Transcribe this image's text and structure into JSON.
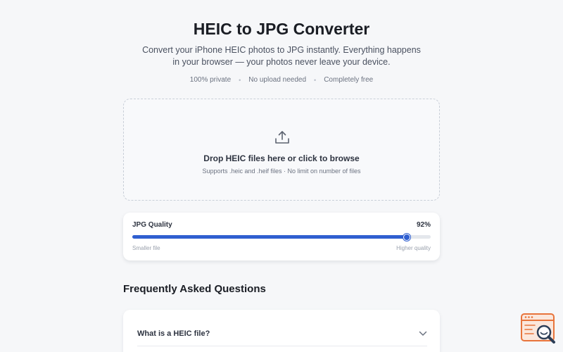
{
  "header": {
    "title": "HEIC to JPG Converter",
    "subtitle": "Convert your iPhone HEIC photos to JPG instantly. Everything happens in your browser — your photos never leave your device.",
    "features": [
      "100% private",
      "No upload needed",
      "Completely free"
    ]
  },
  "dropzone": {
    "icon": "upload-icon",
    "title": "Drop HEIC files here or click to browse",
    "subtitle": "Supports .heic and .heif files · No limit on number of files"
  },
  "quality": {
    "label": "JPG Quality",
    "value_text": "92%",
    "value": 0.92,
    "min_label": "Smaller file",
    "max_label": "Higher quality"
  },
  "faq": {
    "heading": "Frequently Asked Questions",
    "items": [
      {
        "question": "What is a HEIC file?",
        "icon": "chevron-down-icon"
      }
    ]
  },
  "badge": {
    "icon": "search-browser-icon"
  },
  "colors": {
    "accent": "#2f5fd0",
    "badge": "#e8743b"
  }
}
